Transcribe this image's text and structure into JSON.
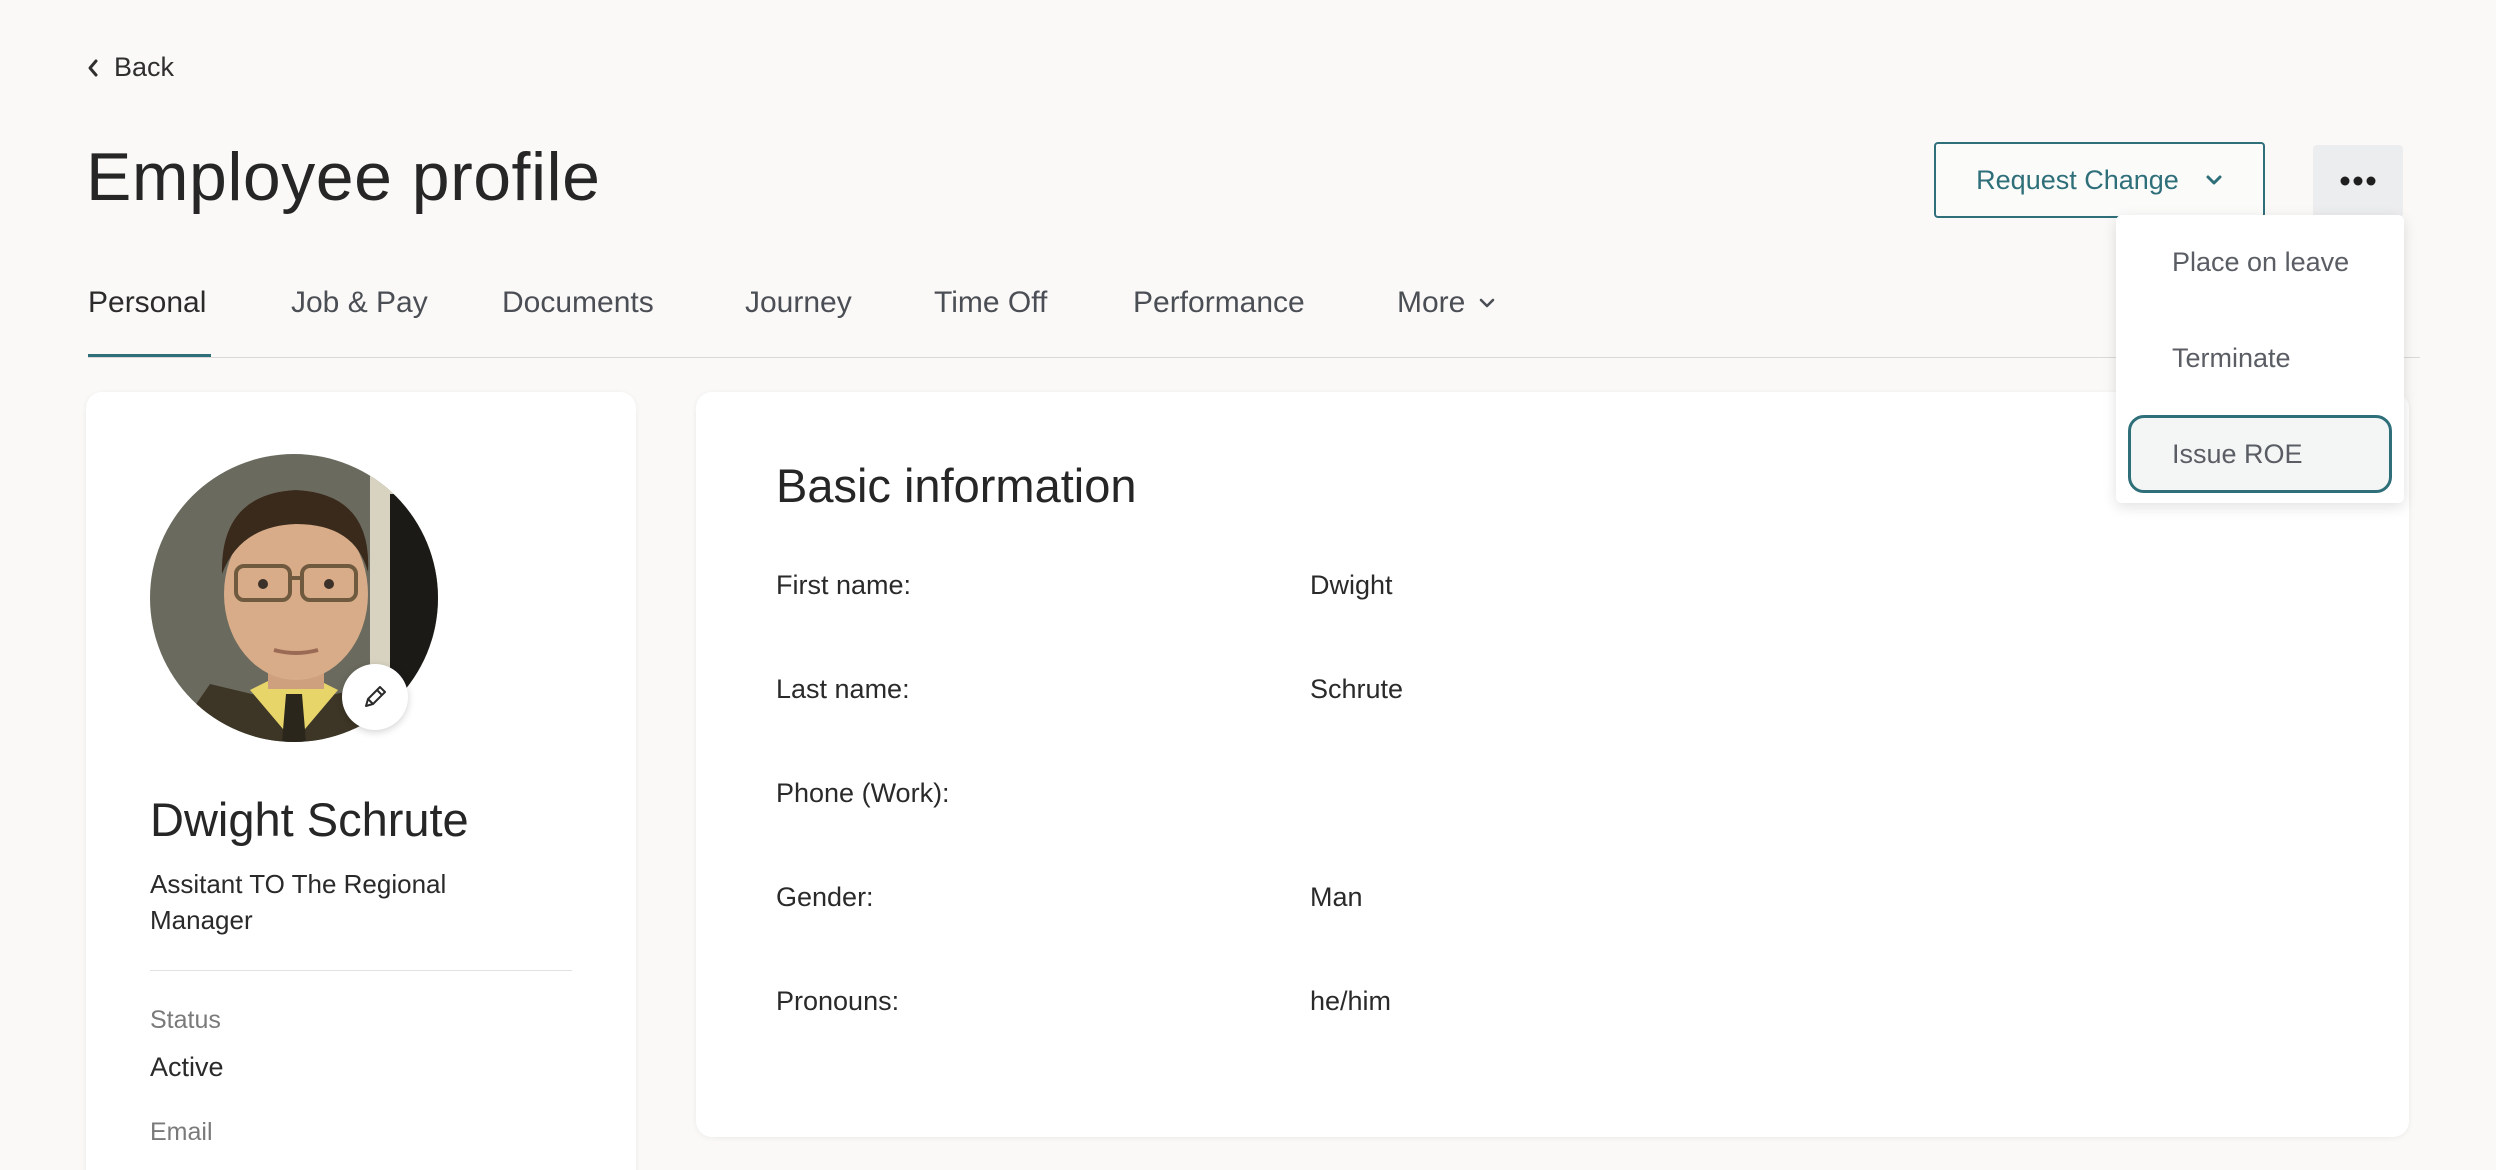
{
  "header": {
    "back_label": "Back",
    "page_title": "Employee profile",
    "request_change_label": "Request Change"
  },
  "tabs": [
    {
      "label": "Personal",
      "active": true
    },
    {
      "label": "Job & Pay"
    },
    {
      "label": "Documents"
    },
    {
      "label": "Journey"
    },
    {
      "label": "Time Off"
    },
    {
      "label": "Performance"
    },
    {
      "label": "More"
    }
  ],
  "actions_menu": {
    "items": [
      {
        "label": "Place on leave"
      },
      {
        "label": "Terminate"
      },
      {
        "label": "Issue ROE",
        "focused": true
      }
    ]
  },
  "profile": {
    "name": "Dwight Schrute",
    "role": "Assitant TO The Regional Manager",
    "status_label": "Status",
    "status_value": "Active",
    "email_label": "Email"
  },
  "basic_info": {
    "title": "Basic information",
    "rows": [
      {
        "label": "First name:",
        "value": "Dwight"
      },
      {
        "label": "Last name:",
        "value": "Schrute"
      },
      {
        "label": "Phone (Work):",
        "value": ""
      },
      {
        "label": "Gender:",
        "value": "Man"
      },
      {
        "label": "Pronouns:",
        "value": "he/him"
      }
    ]
  },
  "colors": {
    "accent": "#2f6f7a",
    "background": "#faf9f7"
  },
  "icons": {
    "back": "chevron-left-icon",
    "request_dropdown": "chevron-down-icon",
    "more_actions": "ellipsis-icon",
    "edit_avatar": "pencil-icon"
  }
}
